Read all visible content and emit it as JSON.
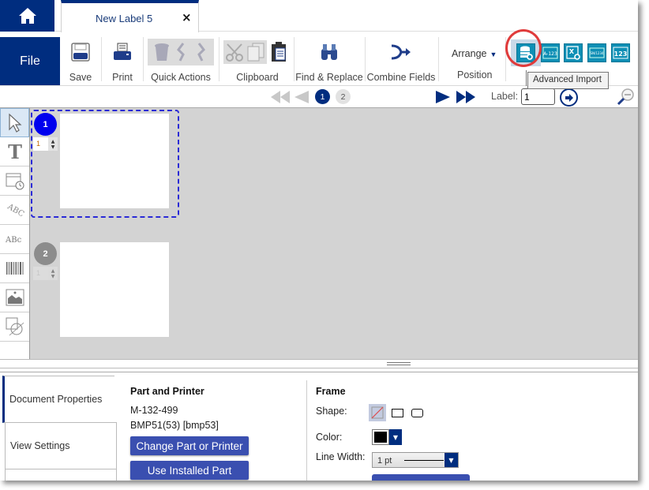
{
  "titlebar": {
    "home_icon": "home-icon",
    "tab_title": "New Label 5",
    "tab_close": "×"
  },
  "ribbon": {
    "file_label": "File",
    "groups": {
      "save": "Save",
      "print": "Print",
      "quick_actions": "Quick Actions",
      "clipboard": "Clipboard",
      "find_replace": "Find & Replace",
      "combine_fields": "Combine Fields",
      "position": "Position"
    },
    "arrange_label": "Arrange",
    "import_buttons": [
      "Advanced Import",
      "Sequence",
      "Excel Import",
      "Serial",
      "Number"
    ],
    "tooltip": "Advanced Import",
    "highlight_color": "#e03b3b"
  },
  "navbar": {
    "pages": [
      "1",
      "2"
    ],
    "current_page": "1",
    "label_text": "Label:",
    "label_value": "1"
  },
  "canvas": {
    "labels": [
      {
        "number": "1",
        "quantity": "1",
        "selected": true,
        "color": "#0000ee"
      },
      {
        "number": "2",
        "quantity": "1",
        "selected": false,
        "color": "#8c8c8c"
      }
    ]
  },
  "properties": {
    "tabs": [
      "Document Properties",
      "View Settings"
    ],
    "part_printer": {
      "title": "Part and Printer",
      "part": "M-132-499",
      "printer": "BMP51(53) [bmp53]",
      "change_button": "Change Part or Printer",
      "installed_button": "Use Installed Part"
    },
    "frame": {
      "title": "Frame",
      "shape_label": "Shape:",
      "color_label": "Color:",
      "color_value": "#000000",
      "line_width_label": "Line Width:",
      "line_width_value": "1 pt"
    }
  },
  "colors": {
    "brand": "#002D7F",
    "import_teal": "#0E8FB5",
    "button_blue": "#3a4fb0"
  }
}
